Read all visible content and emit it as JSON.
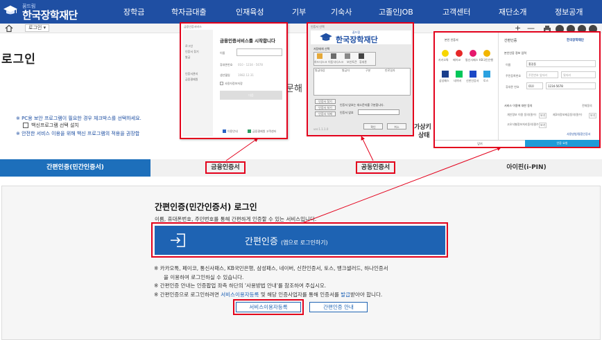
{
  "header": {
    "logo_sub": "꿈드림",
    "logo_main": "한국장학재단",
    "nav": [
      "장학금",
      "학자금대출",
      "인재육성",
      "기부",
      "기숙사",
      "고졸인JOB",
      "고객센터",
      "재단소개",
      "정보공개"
    ]
  },
  "subbar": {
    "breadcrumb": "로그인",
    "plus": "+",
    "minus": "—"
  },
  "page": {
    "title": "로그인",
    "notice1": "※ PC용 보안 프로그램이 필요한 경우 체크박스를 선택하세요.",
    "notice_check": "백신프로그램 선택 설치",
    "notice2": "※ 안전한 서비스 이용을 위해 백신 프로그램의 적용을 권장합",
    "behind_text": "문해",
    "behind_right1": "가상키",
    "behind_right2": "상태"
  },
  "tabs": [
    "간편인증(민간인증서)",
    "금융인증서",
    "공동인증서",
    "아이핀(i-PIN)"
  ],
  "content": {
    "title": "간편인증(민간인증서) 로그인",
    "desc": "이름, 휴대폰번호, 주민번호를 통해 간편하게 인증할 수 있는 서비스입니다.",
    "button_main": "간편인증",
    "button_sub": "(앱으로 로그인하기)",
    "line1": "※ 카카오톡, 페이코, 통신사패스, KB국민은행, 삼성패스, 네이버, 신한인증서, 토스, 뱅크샐러드, 하나인증서",
    "line2": "을 이용하여 로그인하실 수 있습니다.",
    "line3": "※ 간편인증 안내는 인증팝업 좌측 하단의 '사용방법 안내'를 참조하여 주십시오.",
    "line4_pre": "※ 간편인증으로 로그인하려면 ",
    "line4_link1": "서비스이용자등록",
    "line4_mid": " 및 해당 인증사업자를 통해 인증서를 ",
    "line4_link2": "발급",
    "line4_post": "받아야 합니다.",
    "reg_button": "서비스이용자등록",
    "guide_button": "간편인증 안내"
  },
  "popup_fin": {
    "titlebar": "금융인증서비스",
    "heading": "금융인증서비스를 시작합니다",
    "side": [
      "로그인",
      "인증서 찾기",
      "발급",
      "인증서관리",
      "금융결제원"
    ],
    "fields": [
      {
        "label": "이름",
        "placeholder": ""
      },
      {
        "label": "휴대폰번호",
        "placeholder": "010 - 1234 - 5678"
      },
      {
        "label": "생년월일",
        "placeholder": "1982.12.31"
      }
    ],
    "save": "사용자정보저장",
    "next": "다음",
    "footer1": "이용안내",
    "footer2": "금융결제원 고객센터"
  },
  "popup_pub": {
    "titlebar": "인증서 선택",
    "logo_sub": "꿈드림",
    "logo_main": "한국장학재단",
    "location_label": "저장매체 선택",
    "media": [
      "하드디스크",
      "이동식디스크",
      "보안토큰",
      "휴대폰"
    ],
    "columns": [
      "발급대상",
      "발급자",
      "구분",
      "만료일자"
    ],
    "buttons": [
      "인증서 찾기",
      "인증서 보기",
      "인증서 삭제"
    ],
    "pw_note": "인증서 암호는 대소문자를 구분합니다.",
    "pw_label": "인증서 암호",
    "ok": "확인",
    "cancel": "취소",
    "version": "ver.1.1.1.0"
  },
  "popup_simple": {
    "title_left": "본인 인증서",
    "title_right": "간편인증",
    "brand": "한국장학재단",
    "providers": [
      "카카오톡",
      "페이코",
      "통신사패스",
      "KB국민은행",
      "삼성패스",
      "네이버",
      "신한인증서",
      "토스"
    ],
    "form_title": "본인인증 정보 입력",
    "name_label": "이름",
    "name_value": "홍길동",
    "rrn_label": "주민등록번호",
    "rrn_placeholder": "주민번호 앞자리",
    "rrn_placeholder2": "뒷자리",
    "phone_label": "휴대폰 번호",
    "phone_prefix": "010",
    "phone_value": "1234-5678",
    "agree_title": "서비스 이용에 대한 동의",
    "agree_all": "전체동의",
    "agree1": "개인정보 이용 동의(필수)",
    "agree2": "제3자정보제공동의(필수)",
    "agree3": "고유식별정보처리동의(필수)",
    "view": "보기",
    "footer_brand": "사용방법/통합인증서",
    "btn_close": "닫기",
    "btn_req": "인증 요청"
  },
  "colors": {
    "header_bg": "#1f4fa3",
    "tab_active": "#1d6fbb",
    "button_blue": "#1e63b3",
    "highlight_red": "#e3001b",
    "link_blue": "#1a5fb4"
  }
}
